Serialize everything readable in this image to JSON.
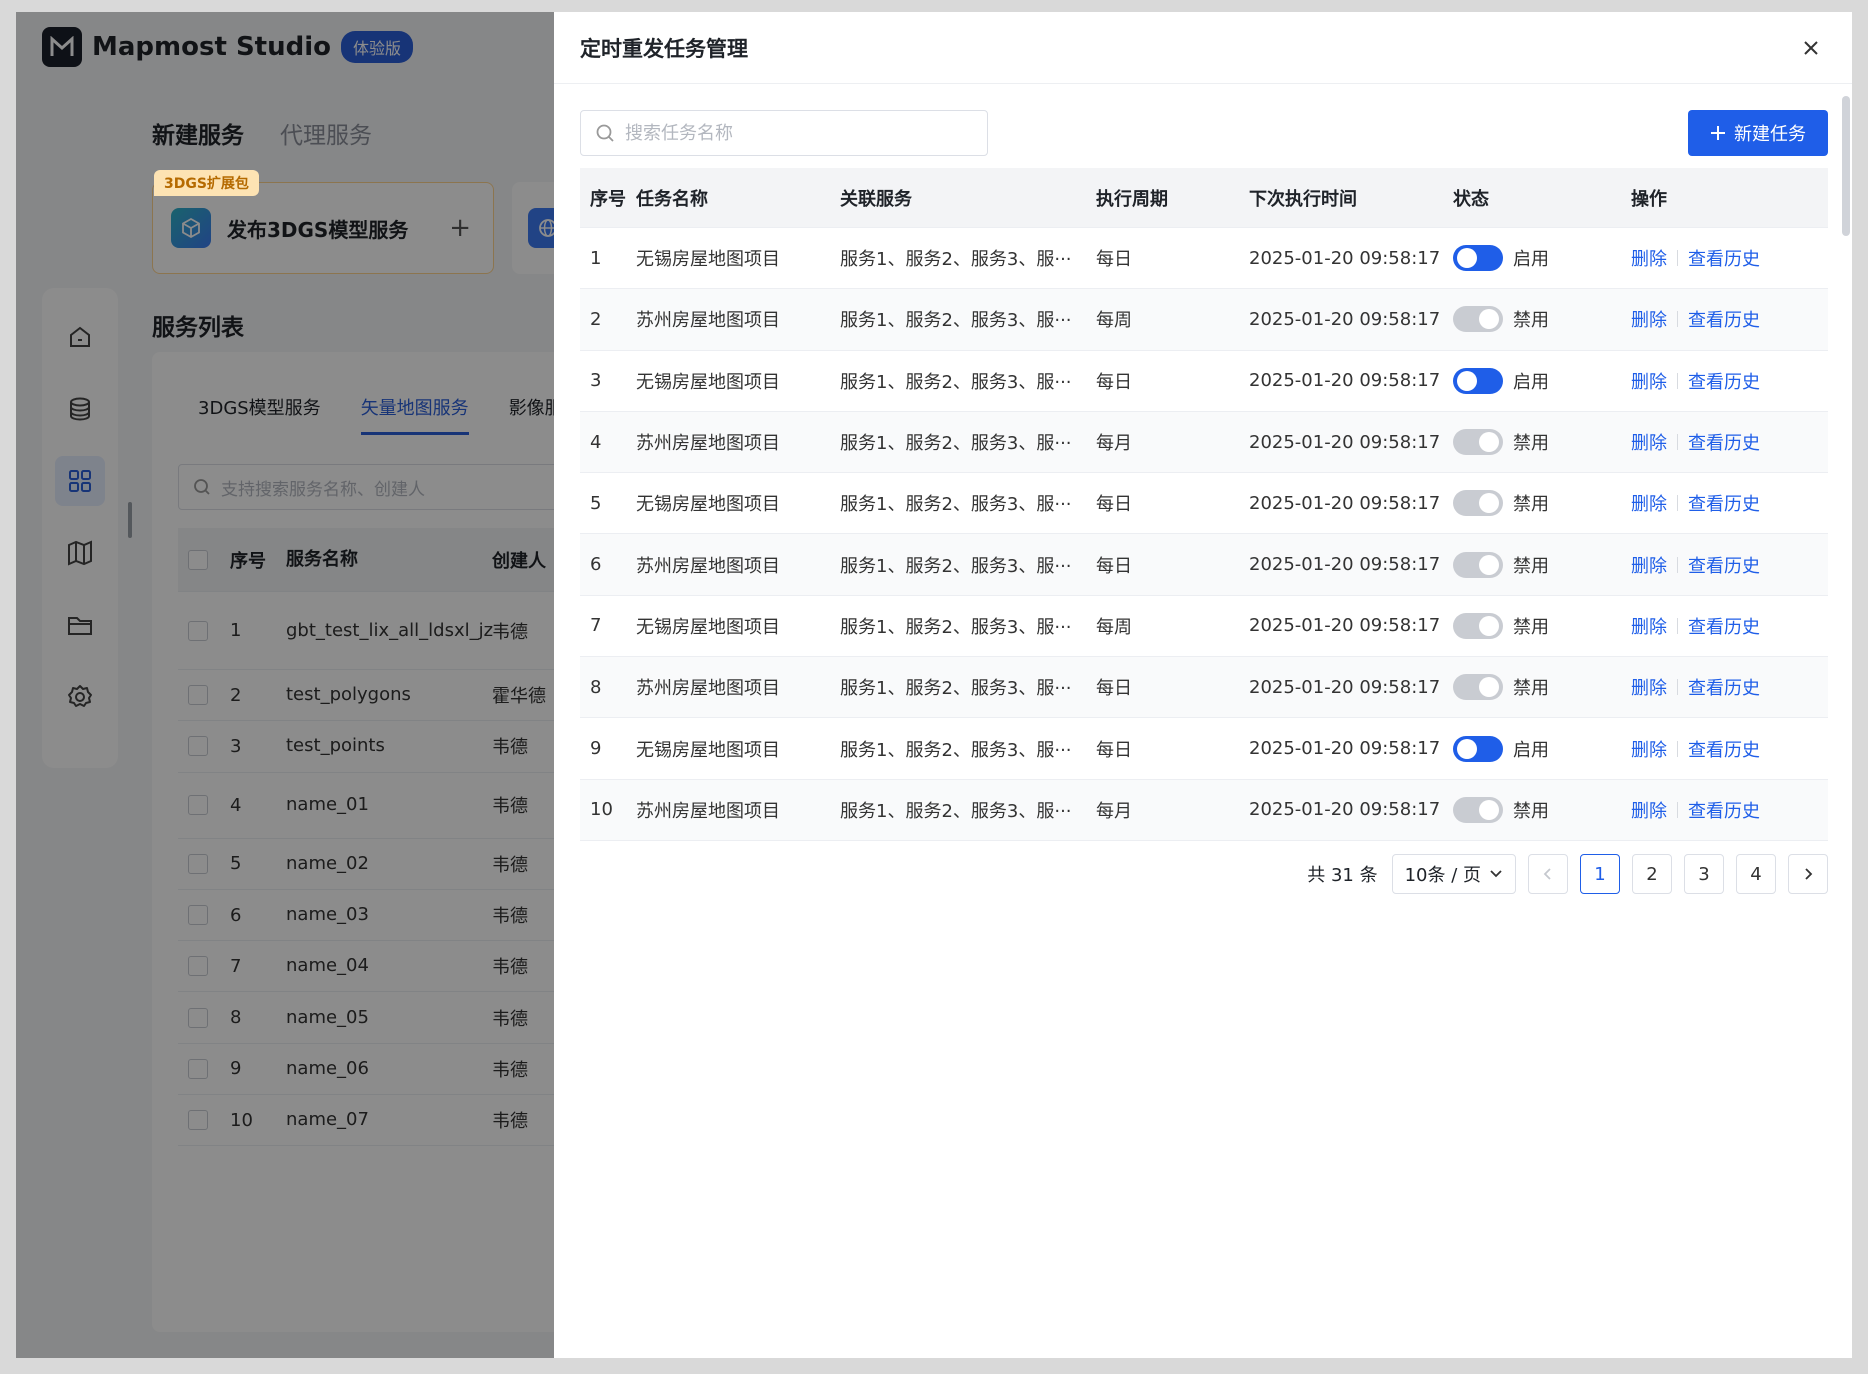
{
  "app": {
    "brand": "Mapmost Studio",
    "badge": "体验版",
    "service_tabs": [
      "新建服务",
      "代理服务"
    ],
    "ext_tag": "3DGS扩展包",
    "publish_card_label": "发布3DGS模型服务",
    "list_title": "服务列表",
    "list_tabs": [
      "3DGS模型服务",
      "矢量地图服务",
      "影像服"
    ],
    "list_search_placeholder": "支持搜索服务名称、创建人",
    "list_headers": {
      "no": "序号",
      "name": "服务名称",
      "creator": "创建人"
    },
    "list_rows": [
      {
        "no": "1",
        "name": "gbt_test_lix_all_ldsxl_jz",
        "creator": "韦德"
      },
      {
        "no": "2",
        "name": "test_polygons",
        "creator": "霍华德"
      },
      {
        "no": "3",
        "name": "test_points",
        "creator": "韦德"
      },
      {
        "no": "4",
        "name": "name_01",
        "creator": "韦德"
      },
      {
        "no": "5",
        "name": "name_02",
        "creator": "韦德"
      },
      {
        "no": "6",
        "name": "name_03",
        "creator": "韦德"
      },
      {
        "no": "7",
        "name": "name_04",
        "creator": "韦德"
      },
      {
        "no": "8",
        "name": "name_05",
        "creator": "韦德"
      },
      {
        "no": "9",
        "name": "name_06",
        "creator": "韦德"
      },
      {
        "no": "10",
        "name": "name_07",
        "creator": "韦德"
      }
    ]
  },
  "drawer": {
    "title": "定时重发任务管理",
    "search_placeholder": "搜索任务名称",
    "new_button": "新建任务",
    "headers": {
      "no": "序号",
      "name": "任务名称",
      "services": "关联服务",
      "period": "执行周期",
      "next": "下次执行时间",
      "status": "状态",
      "ops": "操作"
    },
    "rows": [
      {
        "no": "1",
        "name": "无锡房屋地图项目",
        "services": "服务1、服务2、服务3、服···",
        "period": "每日",
        "next": "2025-01-20 09:58:17",
        "enabled": true,
        "status": "启用"
      },
      {
        "no": "2",
        "name": "苏州房屋地图项目",
        "services": "服务1、服务2、服务3、服···",
        "period": "每周",
        "next": "2025-01-20 09:58:17",
        "enabled": false,
        "status": "禁用"
      },
      {
        "no": "3",
        "name": "无锡房屋地图项目",
        "services": "服务1、服务2、服务3、服···",
        "period": "每日",
        "next": "2025-01-20 09:58:17",
        "enabled": true,
        "status": "启用"
      },
      {
        "no": "4",
        "name": "苏州房屋地图项目",
        "services": "服务1、服务2、服务3、服···",
        "period": "每月",
        "next": "2025-01-20 09:58:17",
        "enabled": false,
        "status": "禁用"
      },
      {
        "no": "5",
        "name": "无锡房屋地图项目",
        "services": "服务1、服务2、服务3、服···",
        "period": "每日",
        "next": "2025-01-20 09:58:17",
        "enabled": false,
        "status": "禁用"
      },
      {
        "no": "6",
        "name": "苏州房屋地图项目",
        "services": "服务1、服务2、服务3、服···",
        "period": "每日",
        "next": "2025-01-20 09:58:17",
        "enabled": false,
        "status": "禁用"
      },
      {
        "no": "7",
        "name": "无锡房屋地图项目",
        "services": "服务1、服务2、服务3、服···",
        "period": "每周",
        "next": "2025-01-20 09:58:17",
        "enabled": false,
        "status": "禁用"
      },
      {
        "no": "8",
        "name": "苏州房屋地图项目",
        "services": "服务1、服务2、服务3、服···",
        "period": "每日",
        "next": "2025-01-20 09:58:17",
        "enabled": false,
        "status": "禁用"
      },
      {
        "no": "9",
        "name": "无锡房屋地图项目",
        "services": "服务1、服务2、服务3、服···",
        "period": "每日",
        "next": "2025-01-20 09:58:17",
        "enabled": true,
        "status": "启用"
      },
      {
        "no": "10",
        "name": "苏州房屋地图项目",
        "services": "服务1、服务2、服务3、服···",
        "period": "每月",
        "next": "2025-01-20 09:58:17",
        "enabled": false,
        "status": "禁用"
      }
    ],
    "ops": {
      "delete": "删除",
      "history": "查看历史"
    },
    "pagination": {
      "total": "共 31 条",
      "page_size": "10条 / 页",
      "pages": [
        "1",
        "2",
        "3",
        "4"
      ],
      "current": "1"
    }
  },
  "colors": {
    "accent": "#1f5ee8",
    "toggle_off": "#c9ccd2",
    "badge": "#2b5fd9"
  }
}
